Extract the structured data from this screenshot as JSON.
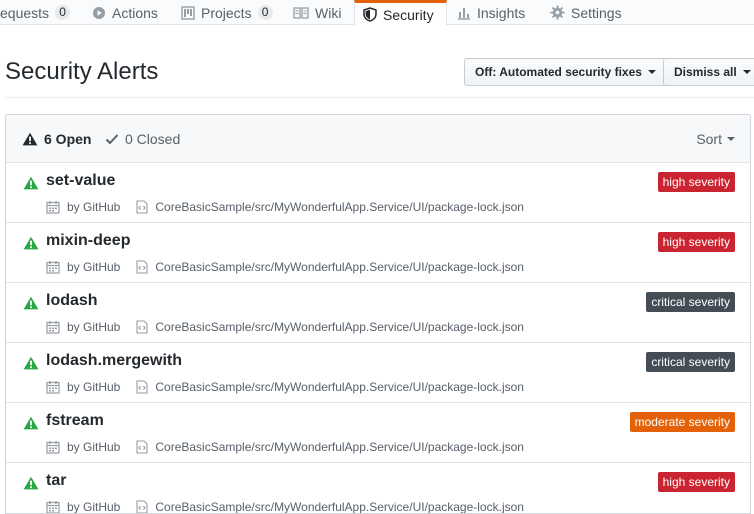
{
  "tabs": {
    "pull_requests": {
      "label": "equests",
      "count": "0"
    },
    "actions": {
      "label": "Actions"
    },
    "projects": {
      "label": "Projects",
      "count": "0"
    },
    "wiki": {
      "label": "Wiki"
    },
    "security": {
      "label": "Security"
    },
    "insights": {
      "label": "Insights"
    },
    "settings": {
      "label": "Settings"
    }
  },
  "header": {
    "title": "Security Alerts",
    "automated_fixes_label": "Off: Automated security fixes",
    "dismiss_all_label": "Dismiss all"
  },
  "filters": {
    "open_label": "6 Open",
    "closed_label": "0 Closed",
    "sort_label": "Sort"
  },
  "alerts": [
    {
      "name": "set-value",
      "by": "by GitHub",
      "path": "CoreBasicSample/src/MyWonderfulApp.Service/UI/package-lock.json",
      "severity": "high severity",
      "severity_color": "#cb2431"
    },
    {
      "name": "mixin-deep",
      "by": "by GitHub",
      "path": "CoreBasicSample/src/MyWonderfulApp.Service/UI/package-lock.json",
      "severity": "high severity",
      "severity_color": "#cb2431"
    },
    {
      "name": "lodash",
      "by": "by GitHub",
      "path": "CoreBasicSample/src/MyWonderfulApp.Service/UI/package-lock.json",
      "severity": "critical severity",
      "severity_color": "#444d56"
    },
    {
      "name": "lodash.mergewith",
      "by": "by GitHub",
      "path": "CoreBasicSample/src/MyWonderfulApp.Service/UI/package-lock.json",
      "severity": "critical severity",
      "severity_color": "#444d56"
    },
    {
      "name": "fstream",
      "by": "by GitHub",
      "path": "CoreBasicSample/src/MyWonderfulApp.Service/UI/package-lock.json",
      "severity": "moderate severity",
      "severity_color": "#e36209"
    },
    {
      "name": "tar",
      "by": "by GitHub",
      "path": "CoreBasicSample/src/MyWonderfulApp.Service/UI/package-lock.json",
      "severity": "high severity",
      "severity_color": "#cb2431"
    }
  ],
  "colors": {
    "alert_icon_green": "#28a745",
    "selected_tab_accent": "#e36209"
  },
  "icons": {
    "actions": "play-circle-icon",
    "projects": "project-board-icon",
    "wiki": "book-icon",
    "security": "shield-icon",
    "insights": "graph-icon",
    "settings": "gear-icon",
    "open": "alert-icon",
    "closed": "check-icon",
    "row": "alert-triangle-icon",
    "by": "calendar-icon",
    "file": "file-code-icon"
  }
}
